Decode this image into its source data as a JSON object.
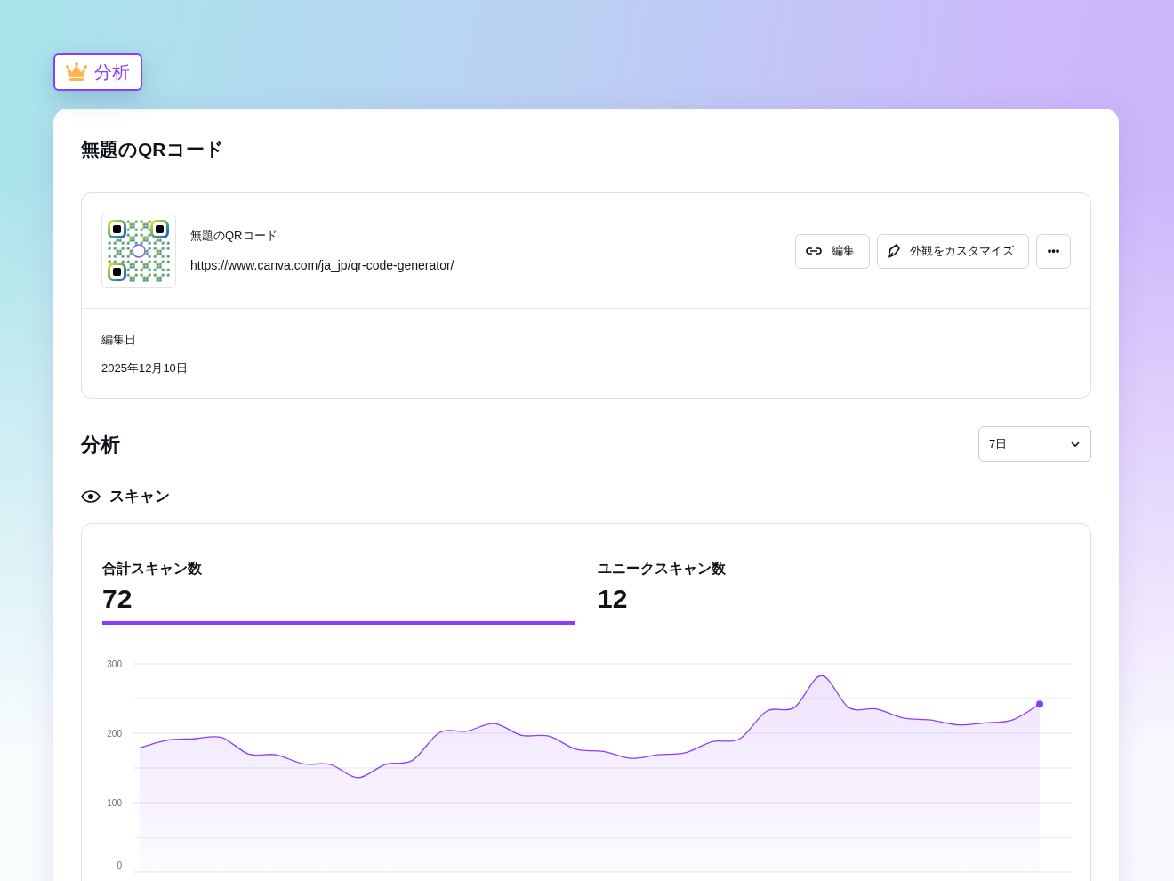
{
  "badge": {
    "label": "分析"
  },
  "title": "無題のQRコード",
  "qr_card": {
    "name": "無題のQRコード",
    "url": "https://www.canva.com/ja_jp/qr-code-generator/",
    "buttons": [
      {
        "kind": "link",
        "label": "編集"
      },
      {
        "kind": "pen",
        "label": "外観をカスタマイズ"
      },
      {
        "kind": "more",
        "label": "•••"
      }
    ],
    "edited_label": "編集日",
    "edited_date": "2025年12月10日"
  },
  "analytics": {
    "heading": "分析",
    "period": "7日",
    "section": "スキャン",
    "stats": [
      {
        "label": "合計スキャン数",
        "value": "72",
        "selected": true
      },
      {
        "label": "ユニークスキャン数",
        "value": "12",
        "selected": false
      }
    ],
    "chart_data": {
      "type": "area",
      "ylim": [
        0,
        300
      ],
      "yticks": [
        0,
        100,
        200,
        300
      ],
      "series": [
        {
          "color": "#8b3dff",
          "values": [
            179,
            190,
            192,
            194,
            170,
            169,
            156,
            155,
            136,
            155,
            161,
            201,
            203,
            214,
            197,
            196,
            177,
            174,
            164,
            169,
            172,
            188,
            192,
            232,
            237,
            283,
            237,
            235,
            222,
            219,
            212,
            215,
            219,
            242
          ]
        }
      ]
    }
  }
}
